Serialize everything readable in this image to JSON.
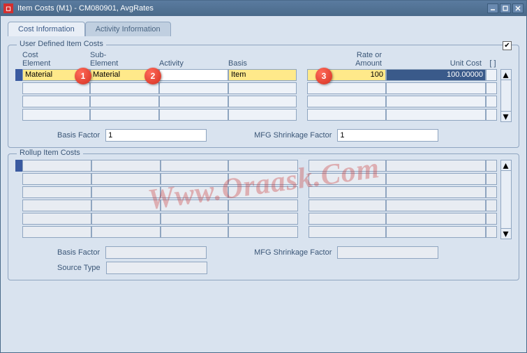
{
  "window": {
    "title": "Item Costs (M1) - CM080901, AvgRates"
  },
  "tabs": {
    "cost_info": "Cost Information",
    "activity_info": "Activity Information"
  },
  "user_costs": {
    "title": "User Defined Item Costs",
    "headers": {
      "cost_element_1": "Cost",
      "cost_element_2": "Element",
      "sub_element_1": "Sub-",
      "sub_element_2": "Element",
      "activity": "Activity",
      "basis": "Basis",
      "rate_1": "Rate or",
      "rate_2": "Amount",
      "unit_cost": "Unit Cost",
      "brackets": "[  ]"
    },
    "row1": {
      "cost_element": "Material",
      "sub_element": "Material",
      "activity": "",
      "basis": "Item",
      "amount": "100",
      "unit_cost": "100.00000"
    },
    "basis_factor_label": "Basis Factor",
    "basis_factor_value": "1",
    "mfg_label": "MFG Shrinkage Factor",
    "mfg_value": "1"
  },
  "rollup": {
    "title": "Rollup Item Costs",
    "basis_factor_label": "Basis Factor",
    "basis_factor_value": "",
    "mfg_label": "MFG Shrinkage Factor",
    "mfg_value": "",
    "source_label": "Source Type",
    "source_value": ""
  },
  "badges": {
    "b1": "1",
    "b2": "2",
    "b3": "3"
  },
  "watermark": "Www.Oraask.Com"
}
